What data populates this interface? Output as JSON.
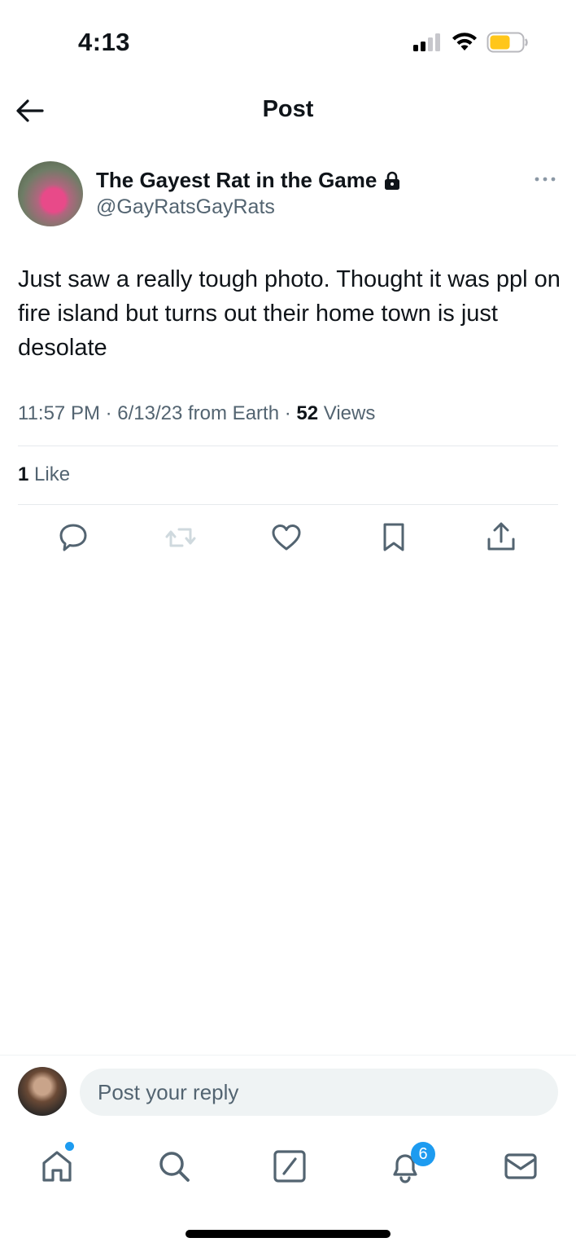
{
  "status_bar": {
    "time": "4:13",
    "signal_icon": "cellular-signal-icon",
    "wifi_icon": "wifi-icon",
    "battery_icon": "battery-icon",
    "battery_color": "#ffc61a"
  },
  "header": {
    "title": "Post",
    "back_icon": "arrow-left-icon"
  },
  "author": {
    "name": "The Gayest Rat in the Game",
    "handle": "@GayRatsGayRats",
    "protected_icon": "lock-icon",
    "more_icon": "more-horizontal-icon"
  },
  "post": {
    "text": "Just saw a really tough photo. Thought it was ppl on fire island but turns out their home town is just desolate",
    "timestamp": "11:57 PM · 6/13/23 from Earth · ",
    "views_count": "52",
    "views_label": " Views",
    "likes_count": "1",
    "likes_label": " Like"
  },
  "actions": [
    {
      "name": "reply",
      "icon": "reply-icon"
    },
    {
      "name": "repost",
      "icon": "repost-icon",
      "disabled": true
    },
    {
      "name": "like",
      "icon": "heart-icon"
    },
    {
      "name": "bookmark",
      "icon": "bookmark-icon"
    },
    {
      "name": "share",
      "icon": "share-icon"
    }
  ],
  "reply_bar": {
    "placeholder": "Post your reply"
  },
  "bottom_nav": {
    "items": [
      "home-icon",
      "search-icon",
      "compose-icon",
      "notifications-icon",
      "messages-icon"
    ],
    "notification_badge": "6"
  },
  "colors": {
    "accent": "#1d9bf0",
    "text": "#0f1419",
    "secondary_text": "#536471",
    "divider": "#e6eaed"
  }
}
